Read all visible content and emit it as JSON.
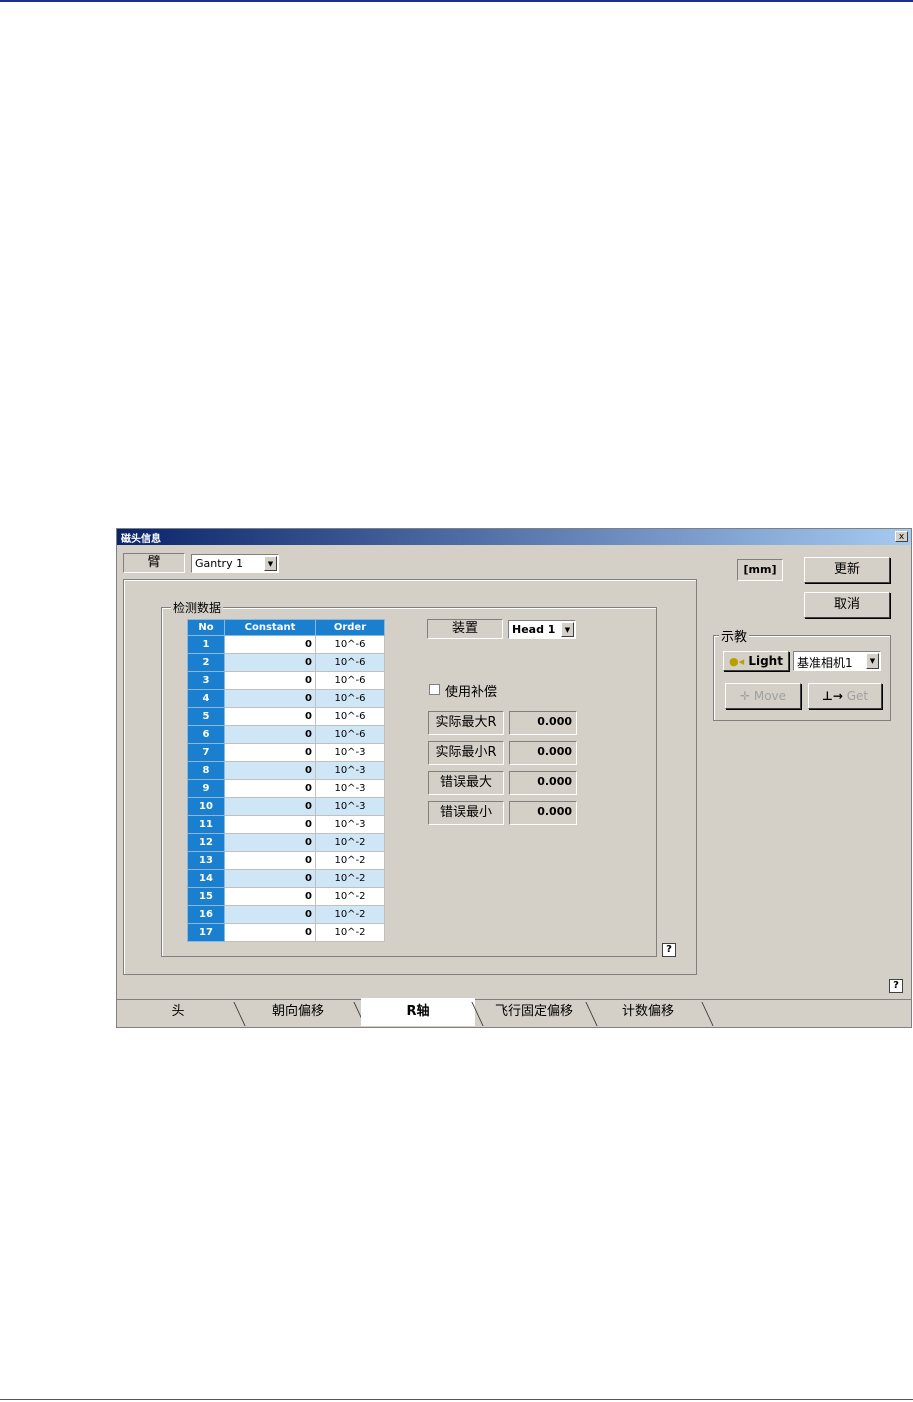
{
  "window": {
    "title": "磁头信息",
    "close_glyph": "x"
  },
  "arm": {
    "label": "臂",
    "combo_value": "Gantry 1"
  },
  "unit_label": "[mm]",
  "buttons": {
    "update": "更新",
    "cancel": "取消",
    "light": "Light",
    "move": "Move",
    "get": "Get"
  },
  "teach": {
    "legend": "示教",
    "camera_value": "基准相机1"
  },
  "inspect": {
    "legend": "检测数据",
    "device_label": "装置",
    "device_value": "Head 1",
    "use_compensation": "使用补偿",
    "fields": [
      {
        "label": "实际最大R",
        "value": "0.000"
      },
      {
        "label": "实际最小R",
        "value": "0.000"
      },
      {
        "label": "错误最大",
        "value": "0.000"
      },
      {
        "label": "错误最小",
        "value": "0.000"
      }
    ]
  },
  "table": {
    "headers": [
      "No",
      "Constant",
      "Order"
    ],
    "rows": [
      {
        "no": "1",
        "constant": "0",
        "order": "10^-6"
      },
      {
        "no": "2",
        "constant": "0",
        "order": "10^-6"
      },
      {
        "no": "3",
        "constant": "0",
        "order": "10^-6"
      },
      {
        "no": "4",
        "constant": "0",
        "order": "10^-6"
      },
      {
        "no": "5",
        "constant": "0",
        "order": "10^-6"
      },
      {
        "no": "6",
        "constant": "0",
        "order": "10^-6"
      },
      {
        "no": "7",
        "constant": "0",
        "order": "10^-3"
      },
      {
        "no": "8",
        "constant": "0",
        "order": "10^-3"
      },
      {
        "no": "9",
        "constant": "0",
        "order": "10^-3"
      },
      {
        "no": "10",
        "constant": "0",
        "order": "10^-3"
      },
      {
        "no": "11",
        "constant": "0",
        "order": "10^-3"
      },
      {
        "no": "12",
        "constant": "0",
        "order": "10^-2"
      },
      {
        "no": "13",
        "constant": "0",
        "order": "10^-2"
      },
      {
        "no": "14",
        "constant": "0",
        "order": "10^-2"
      },
      {
        "no": "15",
        "constant": "0",
        "order": "10^-2"
      },
      {
        "no": "16",
        "constant": "0",
        "order": "10^-2"
      },
      {
        "no": "17",
        "constant": "0",
        "order": "10^-2"
      }
    ]
  },
  "help_glyph": "?",
  "tabs": [
    {
      "label": "头"
    },
    {
      "label": "朝向偏移"
    },
    {
      "label": "R轴"
    },
    {
      "label": "飞行固定偏移"
    },
    {
      "label": "计数偏移"
    }
  ]
}
